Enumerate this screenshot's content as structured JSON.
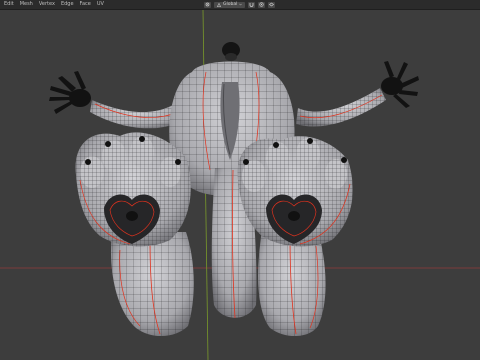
{
  "header": {
    "menu": [
      "Edit",
      "Mesh",
      "Vertex",
      "Edge",
      "Face",
      "UV"
    ],
    "transform_orientation": "Global"
  },
  "viewport": {
    "icons": [
      "snap-magnet-icon",
      "proportional-editing-icon",
      "overlay-icon"
    ],
    "colors": {
      "background": "#3d3d3d",
      "mesh": "#b9b9bd",
      "wire": "#1e1e22",
      "seam": "#e0321e",
      "axis_x": "#8f3b3b",
      "axis_y": "#7a9a2a",
      "vertex": "#111111"
    }
  }
}
